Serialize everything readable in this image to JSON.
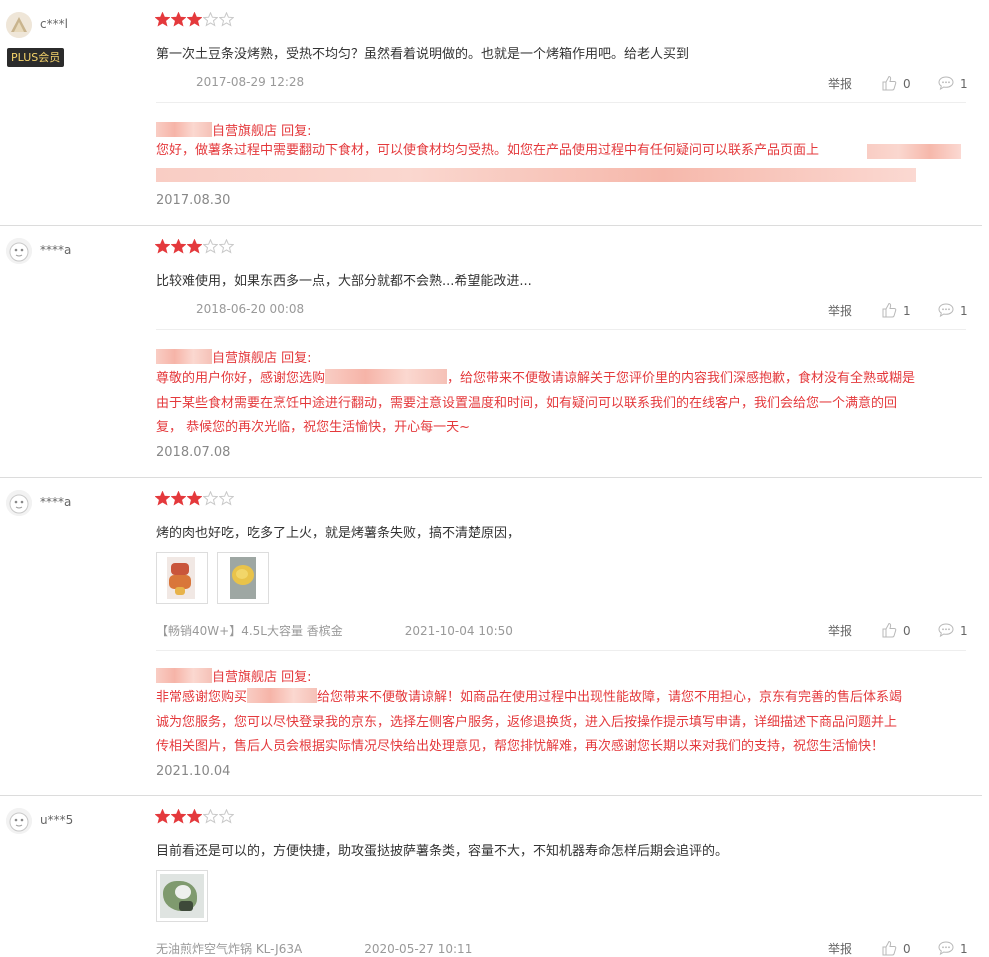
{
  "reviews": [
    {
      "username": "c***l",
      "badge": "PLUS会员",
      "stars": 3,
      "max_stars": 5,
      "text": "第一次土豆条没烤熟，受热不均匀？虽然看着说明做的。也就是一个烤箱作用吧。给老人买到",
      "product": "",
      "date": "2017-08-29 12:28",
      "report_label": "举报",
      "likes": "0",
      "comments": "1",
      "reply": {
        "shop": "自营旗舰店 回复:",
        "body_1": "您好，做薯条过程中需要翻动下食材，可以使食材均匀受热。如您在产品使用过程中有任何疑问可以联系产品页面上",
        "date": "2017.08.30"
      }
    },
    {
      "username": "****a",
      "stars": 3,
      "max_stars": 5,
      "text": "比较难使用，如果东西多一点，大部分就都不会熟...希望能改进...",
      "date": "2018-06-20 00:08",
      "report_label": "举报",
      "likes": "1",
      "comments": "1",
      "reply": {
        "shop": "自营旗舰店 回复:",
        "body_1a": "尊敬的用户你好，感谢您选购",
        "body_1b": "，给您带来不便敬请谅解关于您评价里的内容我们深感抱歉，食材没有全熟或糊是",
        "body_2": "由于某些食材需要在烹饪中途进行翻动，需要注意设置温度和时间，如有疑问可以联系我们的在线客户，我们会给您一个满意的回",
        "body_3": "复， 恭候您的再次光临，祝您生活愉快，开心每一天~",
        "date": "2018.07.08"
      }
    },
    {
      "username": "****a",
      "stars": 3,
      "max_stars": 5,
      "text": "烤的肉也好吃，吃多了上火，就是烤薯条失败，搞不清楚原因，",
      "product": "【畅销40W+】4.5L大容量 香槟金",
      "date": "2021-10-04 10:50",
      "report_label": "举报",
      "likes": "0",
      "comments": "1",
      "reply": {
        "shop": "自营旗舰店 回复:",
        "body_1a": "非常感谢您购买",
        "body_1b": "给您带来不便敬请谅解！如商品在使用过程中出现性能故障，请您不用担心，京东有完善的售后体系竭",
        "body_2": "诚为您服务，您可以尽快登录我的京东，选择左侧客户服务，返修退换货，进入后按操作提示填写申请，详细描述下商品问题并上",
        "body_3": "传相关图片，售后人员会根据实际情况尽快给出处理意见，帮您排忧解难，再次感谢您长期以来对我们的支持，祝您生活愉快！",
        "date": "2021.10.04"
      }
    },
    {
      "username": "u***5",
      "stars": 3,
      "max_stars": 5,
      "text": "目前看还是可以的，方便快捷，助攻蛋挞披萨薯条类，容量不大，不知机器寿命怎样后期会追评的。",
      "product": "无油煎炸空气炸锅 KL-J63A",
      "date": "2020-05-27 10:11",
      "report_label": "举报",
      "likes": "0",
      "comments": "1"
    }
  ],
  "colors": {
    "star_filled": "#e4393c",
    "reply_text": "#e4393c",
    "meta_text": "#999999"
  }
}
